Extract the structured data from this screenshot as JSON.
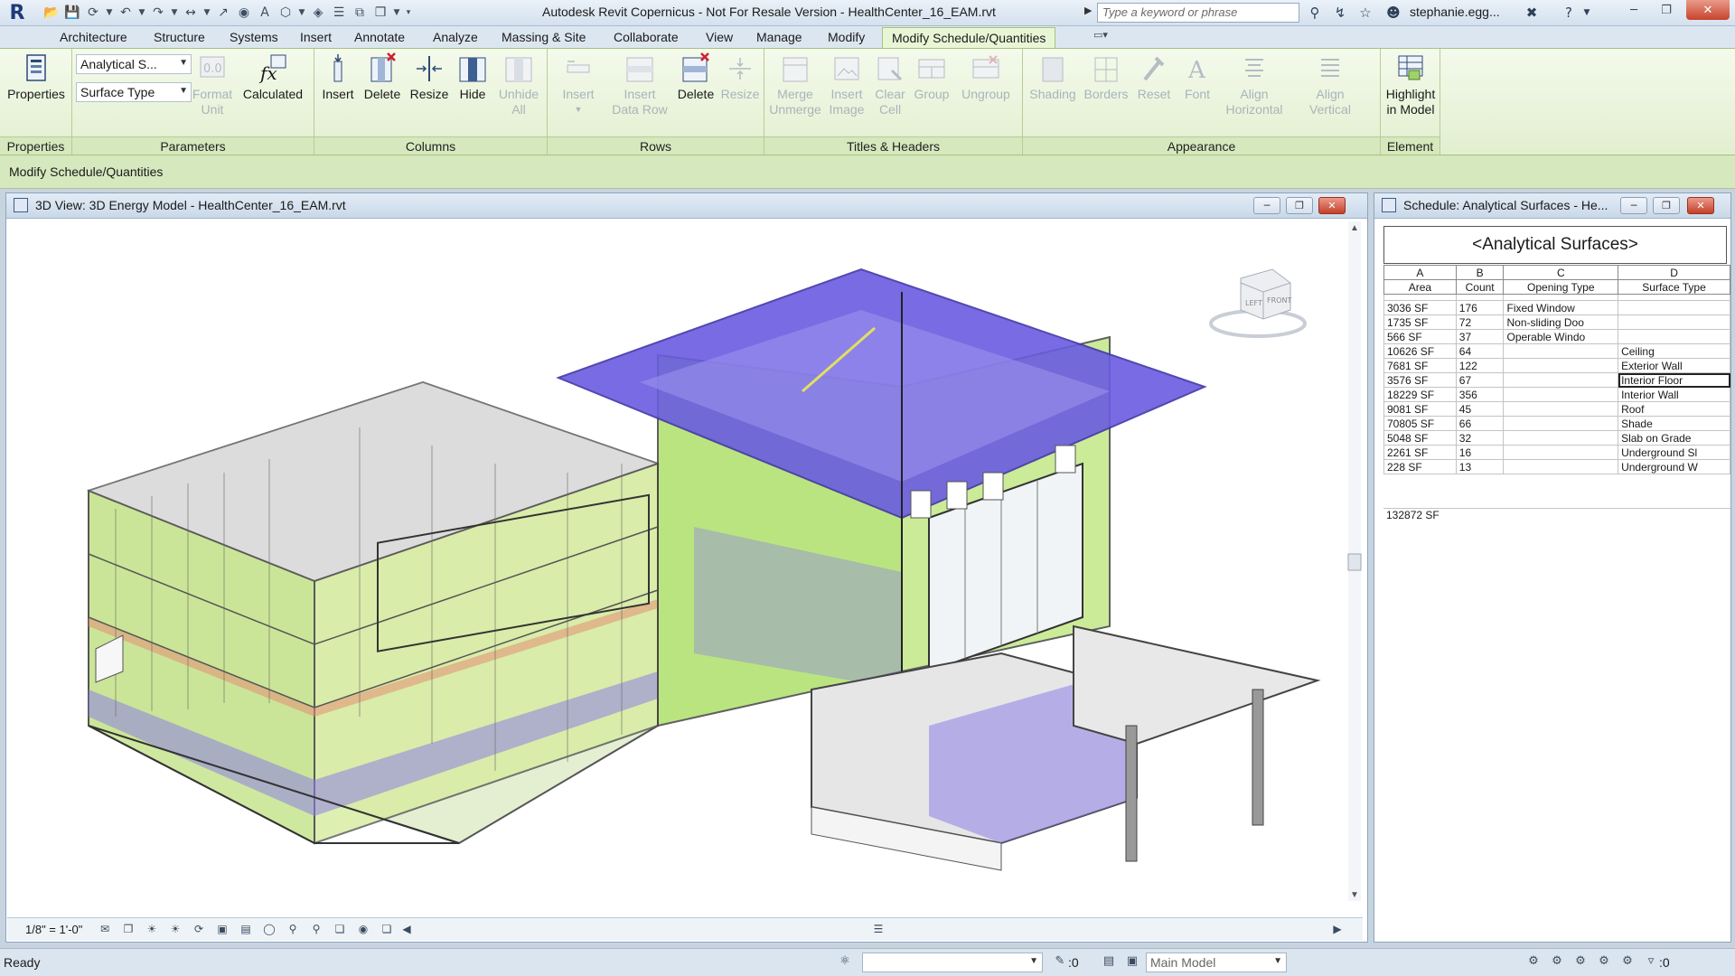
{
  "titlebar": {
    "title": "Autodesk Revit Copernicus - Not For Resale Version -     HealthCenter_16_EAM.rvt",
    "search_placeholder": "Type a keyword or phrase",
    "user": "stephanie.egg...",
    "help": "?"
  },
  "ribbon_tabs": [
    "Architecture",
    "Structure",
    "Systems",
    "Insert",
    "Annotate",
    "Analyze",
    "Massing & Site",
    "Collaborate",
    "View",
    "Manage",
    "Modify"
  ],
  "ribbon_active_tab": "Modify Schedule/Quantities",
  "ribbon": {
    "properties": {
      "button": "Properties",
      "label": "Properties"
    },
    "parameters": {
      "label": "Parameters",
      "dropdown1": "Analytical S...",
      "dropdown2": "Surface Type",
      "format_unit": [
        "Format",
        "Unit"
      ],
      "calculated": "Calculated"
    },
    "columns": {
      "label": "Columns",
      "insert": "Insert",
      "delete": "Delete",
      "resize": "Resize",
      "hide": "Hide",
      "unhide": [
        "Unhide",
        "All"
      ]
    },
    "rows": {
      "label": "Rows",
      "insert": "Insert",
      "insert_data_row": [
        "Insert",
        "Data Row"
      ],
      "delete": "Delete",
      "resize": "Resize"
    },
    "titles_headers": {
      "label": "Titles & Headers",
      "merge": [
        "Merge",
        "Unmerge"
      ],
      "insert_image": [
        "Insert",
        "Image"
      ],
      "clear_cell": [
        "Clear",
        "Cell"
      ],
      "group": "Group",
      "ungroup": "Ungroup"
    },
    "appearance": {
      "label": "Appearance",
      "shading": "Shading",
      "borders": "Borders",
      "reset": "Reset",
      "font": "Font",
      "align_h": [
        "Align",
        "Horizontal"
      ],
      "align_v": [
        "Align",
        "Vertical"
      ]
    },
    "element": {
      "label": "Element",
      "highlight": [
        "Highlight",
        "in Model"
      ]
    }
  },
  "context_bar": {
    "label": "Modify Schedule/Quantities"
  },
  "view3d": {
    "title": "3D View: 3D Energy Model - HealthCenter_16_EAM.rvt",
    "scale": "1/8\" = 1'-0\"",
    "viewcube": {
      "left": "LEFT",
      "front": "FRONT"
    }
  },
  "schedule": {
    "title_bar": "Schedule: Analytical Surfaces - He...",
    "title": "<Analytical Surfaces>",
    "column_letters": [
      "A",
      "B",
      "C",
      "D"
    ],
    "column_names": [
      "Area",
      "Count",
      "Opening Type",
      "Surface Type"
    ],
    "rows": [
      [
        "3036 SF",
        "176",
        "Fixed Window",
        ""
      ],
      [
        "1735 SF",
        "72",
        "Non-sliding Doo",
        ""
      ],
      [
        "566 SF",
        "37",
        "Operable Windo",
        ""
      ],
      [
        "10626 SF",
        "64",
        "",
        "Ceiling"
      ],
      [
        "7681 SF",
        "122",
        "",
        "Exterior Wall"
      ],
      [
        "3576 SF",
        "67",
        "",
        "Interior Floor"
      ],
      [
        "18229 SF",
        "356",
        "",
        "Interior Wall"
      ],
      [
        "9081 SF",
        "45",
        "",
        "Roof"
      ],
      [
        "70805 SF",
        "66",
        "",
        "Shade"
      ],
      [
        "5048 SF",
        "32",
        "",
        "Slab on Grade"
      ],
      [
        "2261 SF",
        "16",
        "",
        "Underground Sl"
      ],
      [
        "228 SF",
        "13",
        "",
        "Underground W"
      ]
    ],
    "total": "132872 SF"
  },
  "statusbar": {
    "status": "Ready",
    "count": ":0",
    "model": "Main Model",
    "filter": ":0"
  },
  "colors": {
    "ribbon_green": "#e2efcf",
    "accent_purple": "#6a5ce0",
    "energy_green": "#b5e35a",
    "close_red": "#c8432b"
  }
}
